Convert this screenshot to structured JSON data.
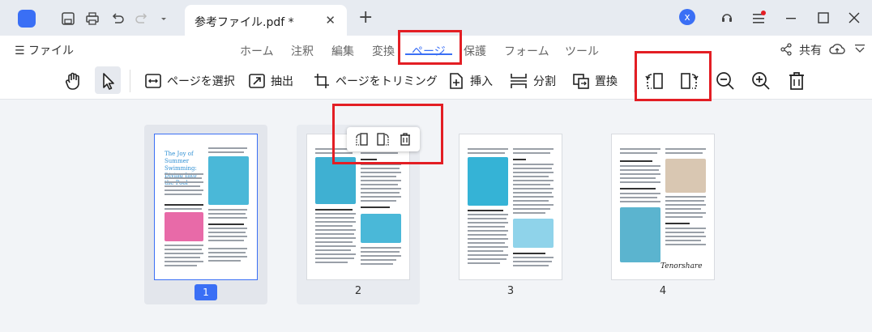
{
  "titlebar": {
    "tab_title": "参考ファイル.pdf *",
    "tab_close": "✕",
    "tab_add": "+",
    "avatar_letter": "x"
  },
  "menubar": {
    "file_label": "☰ ファイル",
    "tabs": [
      {
        "label": "ホーム"
      },
      {
        "label": "注釈"
      },
      {
        "label": "編集"
      },
      {
        "label": "変換"
      },
      {
        "label": "ページ"
      },
      {
        "label": "保護"
      },
      {
        "label": "フォーム"
      },
      {
        "label": "ツール"
      }
    ],
    "active_tab": "ページ",
    "share_label": "共有"
  },
  "toolbar": {
    "select_page": "ページを選択",
    "extract": "抽出",
    "trim": "ページをトリミング",
    "insert": "挿入",
    "split": "分割",
    "replace": "置換"
  },
  "pages": [
    {
      "number": "1",
      "selected": true,
      "heading": "The Joy of Summer Swimming: Diving Into the Pool"
    },
    {
      "number": "2",
      "selected": false
    },
    {
      "number": "3",
      "selected": false
    },
    {
      "number": "4",
      "selected": false,
      "signature": "Tenorshare"
    }
  ],
  "colors": {
    "accent": "#3a6ff5",
    "highlight_box": "#e31e24"
  }
}
